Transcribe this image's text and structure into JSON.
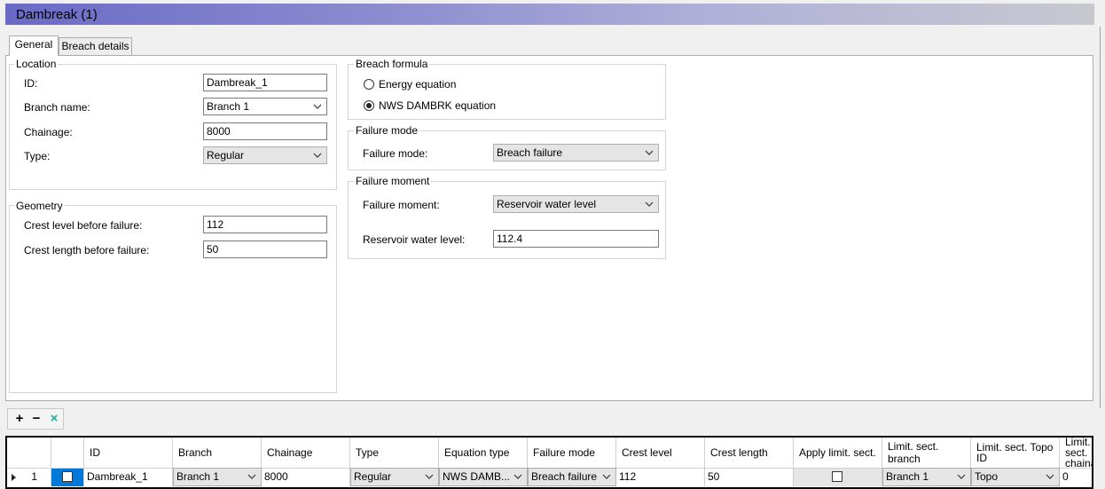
{
  "window": {
    "title": "Dambreak (1)"
  },
  "tabs": [
    {
      "label": "General",
      "active": true
    },
    {
      "label": "Breach details",
      "active": false
    }
  ],
  "location": {
    "legend": "Location",
    "id_label": "ID:",
    "id_value": "Dambreak_1",
    "branch_label": "Branch name:",
    "branch_value": "Branch 1",
    "chainage_label": "Chainage:",
    "chainage_value": "8000",
    "type_label": "Type:",
    "type_value": "Regular"
  },
  "geometry": {
    "legend": "Geometry",
    "crest_level_label": "Crest level before failure:",
    "crest_level_value": "112",
    "crest_length_label": "Crest length before failure:",
    "crest_length_value": "50"
  },
  "breach_formula": {
    "legend": "Breach formula",
    "options": [
      {
        "label": "Energy equation",
        "selected": false
      },
      {
        "label": "NWS DAMBRK equation",
        "selected": true
      }
    ]
  },
  "failure_mode": {
    "legend": "Failure mode",
    "label": "Failure mode:",
    "value": "Breach failure"
  },
  "failure_moment": {
    "legend": "Failure moment",
    "label": "Failure moment:",
    "value": "Reservoir water level",
    "level_label": "Reservoir water level:",
    "level_value": "112.4"
  },
  "toolbar": {
    "add": "+",
    "remove": "−",
    "clear": "×"
  },
  "table": {
    "columns": [
      "",
      "ID",
      "Branch",
      "Chainage",
      "Type",
      "Equation type",
      "Failure mode",
      "Crest level",
      "Crest length",
      "Apply limit. sect.",
      "Limit. sect. branch",
      "Limit. sect. Topo ID",
      "Limit. sect. chainage"
    ],
    "rows": [
      {
        "num": "1",
        "selected": false,
        "id": "Dambreak_1",
        "branch": "Branch 1",
        "chainage": "8000",
        "type": "Regular",
        "equation": "NWS DAMB...",
        "failure_mode": "Breach failure",
        "crest_level": "112",
        "crest_length": "50",
        "apply_limit": false,
        "limit_branch": "Branch 1",
        "topo_id": "Topo",
        "limit_chainage": "0"
      }
    ]
  },
  "colors": {
    "title_start": "#6a6ac6",
    "title_end": "#c8c8d0",
    "selection": "#0078d7"
  },
  "icons": {
    "dropdown": "chevron-down-icon",
    "row_indicator": "triangle-right-icon",
    "add": "plus-icon",
    "remove": "minus-icon",
    "clear": "close-icon"
  }
}
